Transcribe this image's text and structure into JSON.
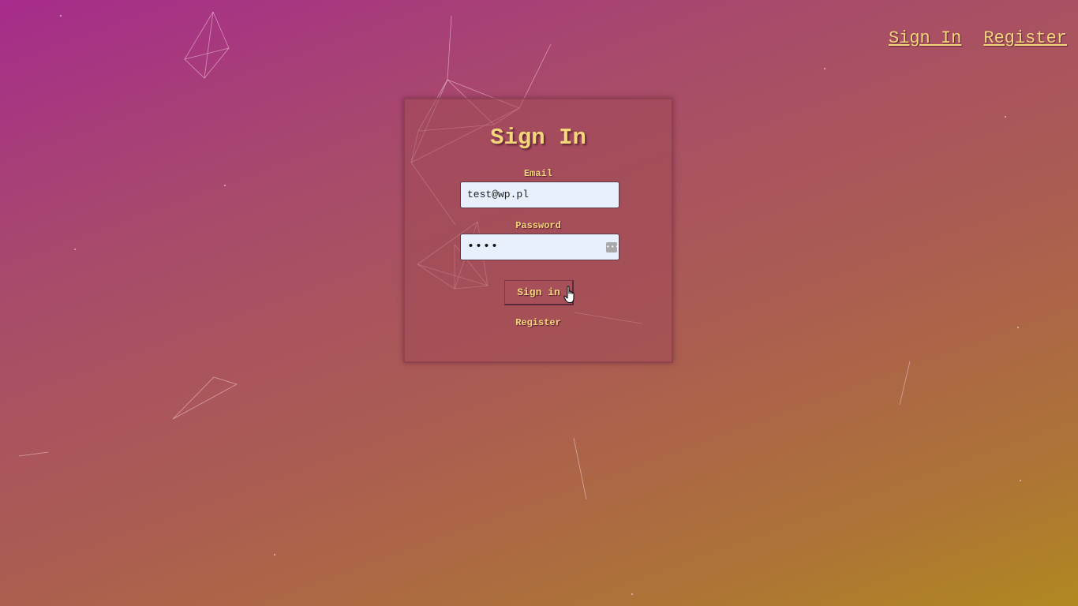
{
  "nav": {
    "signin_label": "Sign In",
    "register_label": "Register"
  },
  "form": {
    "title": "Sign In",
    "email_label": "Email",
    "email_value": "test@wp.pl",
    "password_label": "Password",
    "password_masked": "••••",
    "submit_label": "Sign in",
    "register_label": "Register"
  },
  "colors": {
    "accent_text": "#f5d67a",
    "input_bg": "#e8f0fe"
  }
}
